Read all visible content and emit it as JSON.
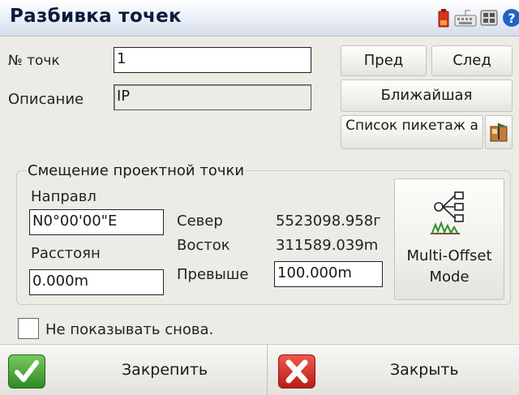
{
  "title": "Разбивка точек",
  "header_icons": [
    "battery-icon",
    "keyboard-icon",
    "controller-icon",
    "help-icon"
  ],
  "point_no": {
    "label": "№ точк",
    "value": "1"
  },
  "description": {
    "label": "Описание",
    "value": "IP"
  },
  "buttons": {
    "prev": "Пред",
    "next": "След",
    "nearest": "Ближайшая",
    "station_list": "Список пикетаж а"
  },
  "offset_group": {
    "legend": "Смещение проектной точки",
    "direction_label": "Направл",
    "direction_value": "N0°00'00\"E",
    "distance_label": "Расстоян",
    "distance_value": "0.000m",
    "north_label": "Север",
    "north_value": "5523098.958г",
    "east_label": "Восток",
    "east_value": "311589.039m",
    "elev_label": "Превыше",
    "elev_value": "100.000m",
    "multi_offset_label": "Multi-Offset Mode"
  },
  "dont_show": {
    "label": "Не показывать снова.",
    "checked": false
  },
  "bottom": {
    "stakeout_label": "Закрепить",
    "close_label": "Закрыть"
  },
  "colors": {
    "accent_green": "#3a9a2f",
    "accent_red": "#d4332a",
    "title_text": "#0d1b3a"
  }
}
